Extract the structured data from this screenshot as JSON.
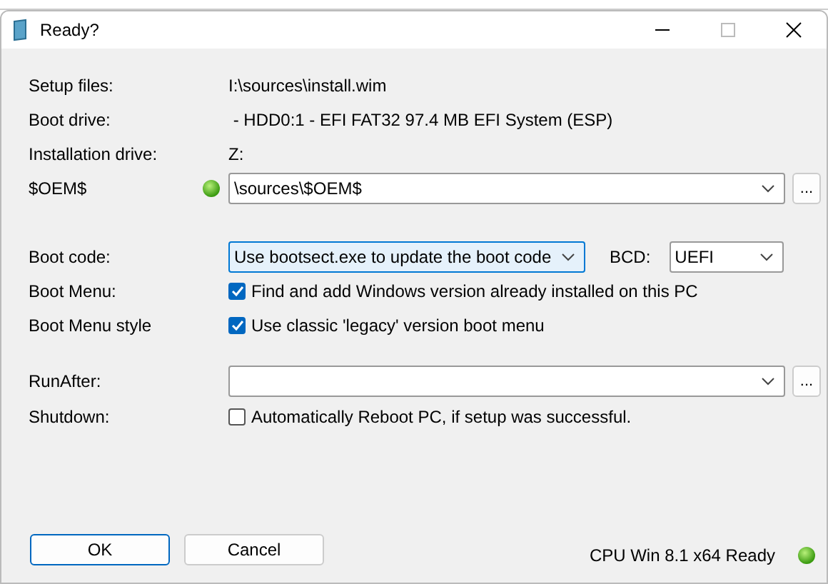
{
  "window": {
    "title": "Ready?"
  },
  "info_rows": [
    {
      "label": "Setup files:",
      "value": "I:\\sources\\install.wim"
    },
    {
      "label": "Boot drive:",
      "value": " - HDD0:1 - EFI FAT32 97.4 MB EFI System (ESP)"
    },
    {
      "label": "Installation drive:",
      "value": "Z:"
    }
  ],
  "oem": {
    "label": "$OEM$",
    "status_on": true,
    "value": "\\sources\\$OEM$",
    "browse": "..."
  },
  "boot_code": {
    "label": "Boot code:",
    "value": "Use bootsect.exe to update the boot code",
    "focused": true
  },
  "bcd": {
    "label": "BCD:",
    "value": "UEFI"
  },
  "checks": [
    {
      "label": "Boot Menu:",
      "text": "Find and add Windows version already installed on this PC",
      "checked": true
    },
    {
      "label": "Boot Menu style",
      "text": "Use classic 'legacy' version boot menu",
      "checked": true
    }
  ],
  "run_after": {
    "label": "RunAfter:",
    "browse": "..."
  },
  "shutdown": {
    "label": "Shutdown:",
    "text": "Automatically Reboot PC, if setup was successful.",
    "checked": false
  },
  "buttons": [
    {
      "label": "OK",
      "default": true
    },
    {
      "label": "Cancel",
      "default": false
    }
  ],
  "status": {
    "text": "CPU Win 8.1 x64 Ready",
    "on": true
  }
}
